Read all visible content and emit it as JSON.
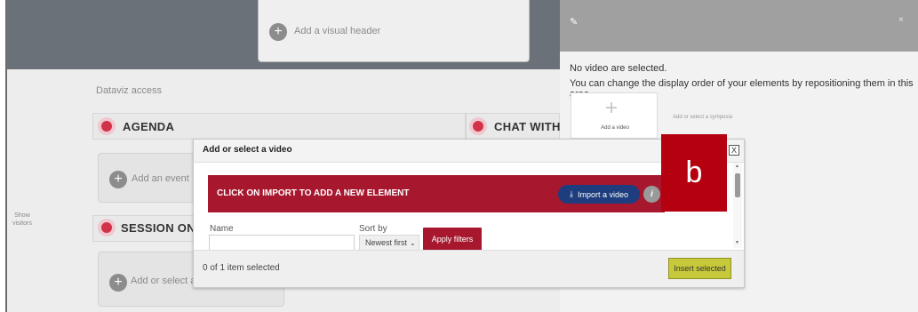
{
  "header": {
    "add_visual_header": "Add a visual header"
  },
  "canvas": {
    "dataviz_label": "Dataviz access",
    "sections": {
      "agenda": "AGENDA",
      "chat": "CHAT WITH TE",
      "session": "SESSION ON"
    },
    "add_event": "Add an event",
    "add_select_video": "Add or select a vi",
    "show_visitors": "Show visitors"
  },
  "right_panel": {
    "edit_icon": "pencil-icon",
    "close_label": "×",
    "no_video": "No video are selected.",
    "reorder_hint": "You can change the display order of your elements by repositioning them in this area.",
    "add_video": "Add a video",
    "add_select_symposia": "Add or select a symposia"
  },
  "modal": {
    "title": "Add or select a video",
    "close_label": "X",
    "banner_text": "CLICK ON IMPORT TO ADD A NEW ELEMENT",
    "import_button": "Import a video",
    "info_label": "i",
    "filters": {
      "name_label": "Name",
      "name_value": "",
      "sort_label": "Sort by",
      "sort_value": "Newest first",
      "apply_button": "Apply filters"
    },
    "footer": {
      "selected_count": "0 of 1 item selected",
      "insert_button": "Insert selected"
    }
  },
  "annotation": {
    "letter": "b",
    "color": "#b5000f"
  },
  "colors": {
    "brand_red": "#a7182f",
    "import_blue": "#1d3d7e",
    "insert_yellow": "#c8c93a"
  }
}
